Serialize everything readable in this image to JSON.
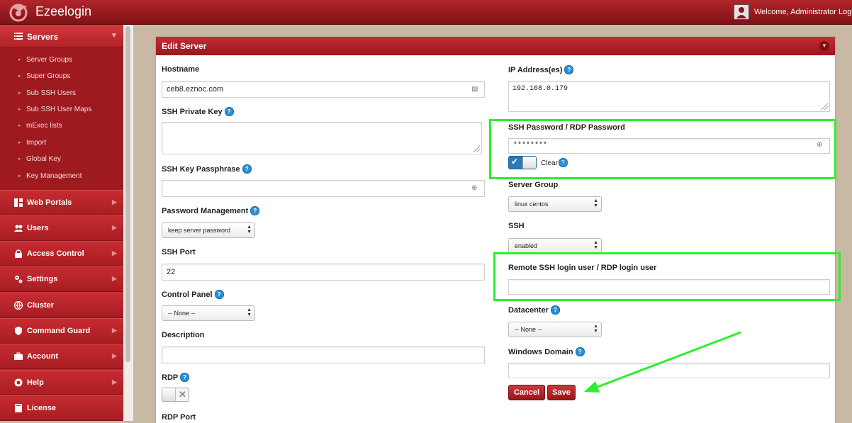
{
  "app": {
    "title": "Ezeelogin"
  },
  "header": {
    "welcome_text": "Welcome, Administrator",
    "logout_label": "Logout"
  },
  "sidebar": {
    "section": "Servers",
    "sub_items": [
      "Server Groups",
      "Super Groups",
      "Sub SSH Users",
      "Sub SSH User Maps",
      "mExec lists",
      "Import",
      "Global Key",
      "Key Management"
    ],
    "items": [
      "Web Portals",
      "Users",
      "Access Control",
      "Settings",
      "Cluster",
      "Command Guard",
      "Account",
      "Help",
      "License"
    ]
  },
  "panel": {
    "title": "Edit Server"
  },
  "form": {
    "hostname": {
      "label": "Hostname",
      "value": "ceb8.eznoc.com"
    },
    "ssh_private_key": {
      "label": "SSH Private Key",
      "value": ""
    },
    "ssh_key_passphrase": {
      "label": "SSH Key Passphrase",
      "value": ""
    },
    "password_management": {
      "label": "Password Management",
      "value": "keep server password"
    },
    "ssh_port": {
      "label": "SSH Port",
      "value": "22"
    },
    "control_panel": {
      "label": "Control Panel",
      "value": "-- None --"
    },
    "description": {
      "label": "Description",
      "value": ""
    },
    "rdp": {
      "label": "RDP",
      "enabled": false
    },
    "rdp_port": {
      "label": "RDP Port"
    },
    "ip_address": {
      "label": "IP Address(es)",
      "value": "192.168.0.179"
    },
    "ssh_password": {
      "label": "SSH Password / RDP Password",
      "value": "********",
      "clear_label": "Clear",
      "clear_checked": true
    },
    "server_group": {
      "label": "Server Group",
      "value": "linux centos"
    },
    "ssh": {
      "label": "SSH",
      "value": "enabled"
    },
    "remote_login_user": {
      "label": "Remote SSH login user / RDP login user",
      "value": ""
    },
    "datacenter": {
      "label": "Datacenter",
      "value": "-- None --"
    },
    "windows_domain": {
      "label": "Windows Domain",
      "value": ""
    }
  },
  "buttons": {
    "cancel": "Cancel",
    "save": "Save"
  },
  "annotation": {
    "highlight_color": "#2cf02c"
  }
}
